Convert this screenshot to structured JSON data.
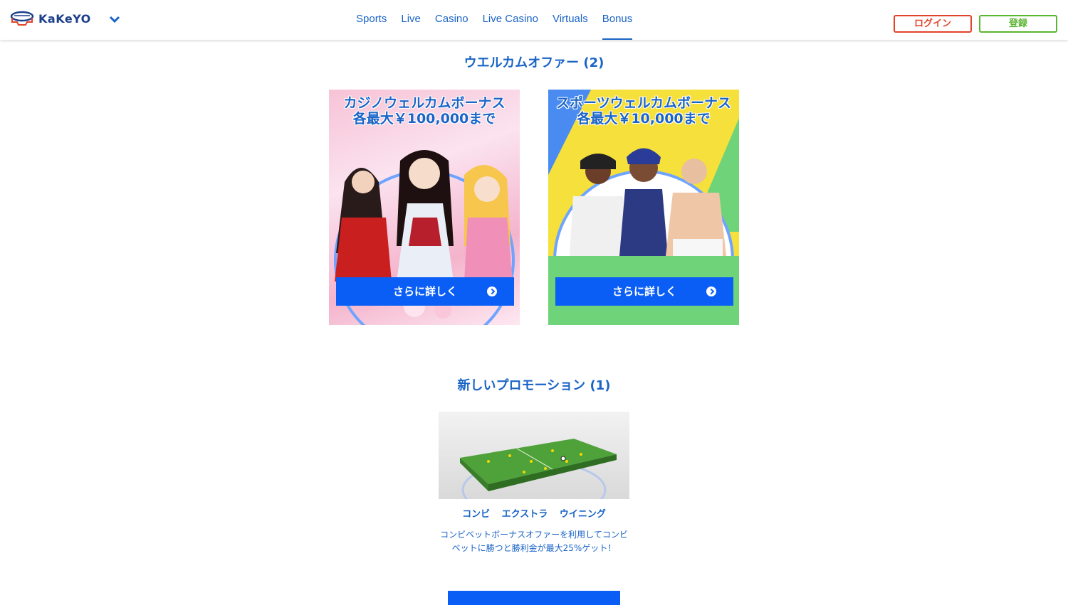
{
  "header": {
    "logo_text": "KaKeYO",
    "nav": [
      "Sports",
      "Live",
      "Casino",
      "Live Casino",
      "Virtuals",
      "Bonus"
    ],
    "active_nav": "Bonus",
    "login_label": "ログイン",
    "register_label": "登録"
  },
  "welcome": {
    "title": "ウエルカムオファー (2)",
    "cards": [
      {
        "title": "カジノウェルカムボーナス 各最大￥100,000まで",
        "button": "さらに詳しく"
      },
      {
        "title": "スポーツウェルカムボーナス各最大￥10,000まで",
        "button": "さらに詳しく"
      }
    ]
  },
  "promotions": {
    "title": "新しいプロモーション (1)",
    "items": [
      {
        "title": "コンビ エクストラ ウイニング",
        "description": "コンビベットボーナスオファーを利用してコンビベットに勝つと勝利金が最大25%ゲット！"
      }
    ]
  },
  "colors": {
    "brand_blue": "#1a64c7",
    "button_blue": "#0a5ef5",
    "login_red": "#e2432a",
    "register_green": "#5ab52f"
  }
}
